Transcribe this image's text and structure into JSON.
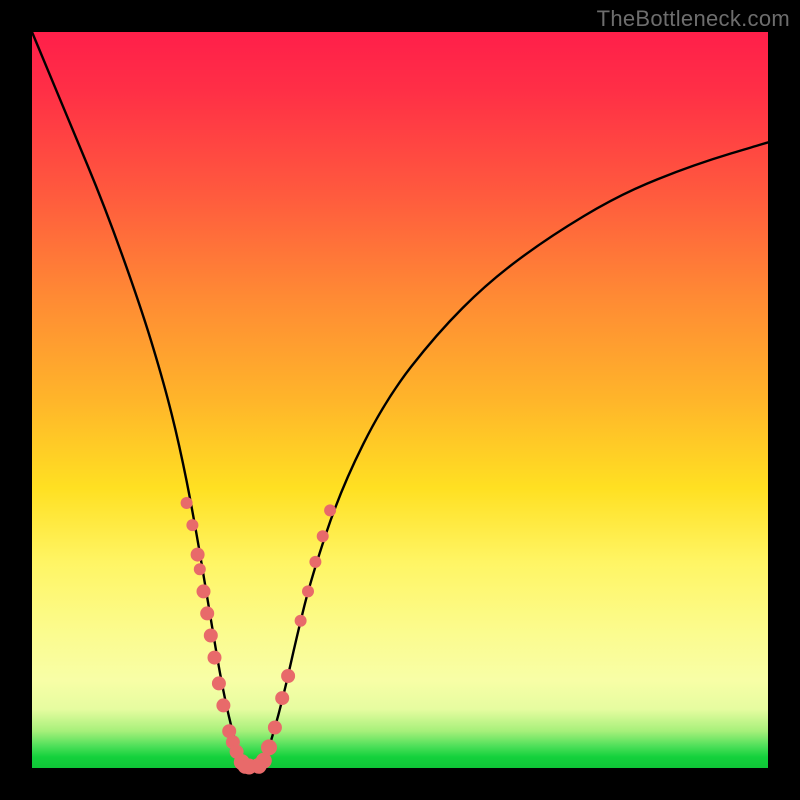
{
  "watermark": "TheBottleneck.com",
  "colors": {
    "frame": "#000000",
    "curve": "#000000",
    "dot": "#e86a6a",
    "gradient_stops": [
      "#ff1f4a",
      "#ff5a3e",
      "#ff8a34",
      "#ffb52a",
      "#ffe022",
      "#fbfc90",
      "#4fe05a",
      "#0fc637"
    ]
  },
  "chart_data": {
    "type": "line",
    "title": "",
    "xlabel": "",
    "ylabel": "",
    "xlim": [
      0,
      100
    ],
    "ylim": [
      0,
      100
    ],
    "note": "V-shaped bottleneck curve; y≈100 at edges (red zone), y≈0 at valley (green zone). Vertical color bands map to y-value: 100=red, ~50=yellow, 0=green. Pink dots mark sample points near valley walls.",
    "series": [
      {
        "name": "bottleneck-curve",
        "x": [
          0,
          5,
          10,
          15,
          18,
          20,
          22,
          24,
          26,
          28,
          29,
          30,
          31,
          32,
          34,
          36,
          38,
          42,
          48,
          55,
          62,
          70,
          80,
          90,
          100
        ],
        "y": [
          100,
          88,
          76,
          62,
          52,
          44,
          34,
          22,
          10,
          2,
          0,
          0,
          0,
          2,
          9,
          18,
          26,
          38,
          50,
          59,
          66,
          72,
          78,
          82,
          85
        ]
      }
    ],
    "sample_points": {
      "name": "dots",
      "x": [
        21.0,
        21.8,
        22.5,
        22.8,
        23.3,
        23.8,
        24.3,
        24.8,
        25.4,
        26.0,
        26.8,
        27.3,
        27.8,
        28.5,
        29.0,
        29.5,
        30.8,
        31.5,
        32.2,
        33.0,
        34.0,
        34.8,
        36.5,
        37.5,
        38.5,
        39.5,
        40.5
      ],
      "y": [
        36.0,
        33.0,
        29.0,
        27.0,
        24.0,
        21.0,
        18.0,
        15.0,
        11.5,
        8.5,
        5.0,
        3.5,
        2.2,
        0.8,
        0.3,
        0.2,
        0.3,
        1.0,
        2.8,
        5.5,
        9.5,
        12.5,
        20.0,
        24.0,
        28.0,
        31.5,
        35.0
      ],
      "r": [
        6,
        6,
        7,
        6,
        7,
        7,
        7,
        7,
        7,
        7,
        7,
        7,
        7,
        8,
        8,
        8,
        8,
        8,
        8,
        7,
        7,
        7,
        6,
        6,
        6,
        6,
        6
      ]
    }
  }
}
